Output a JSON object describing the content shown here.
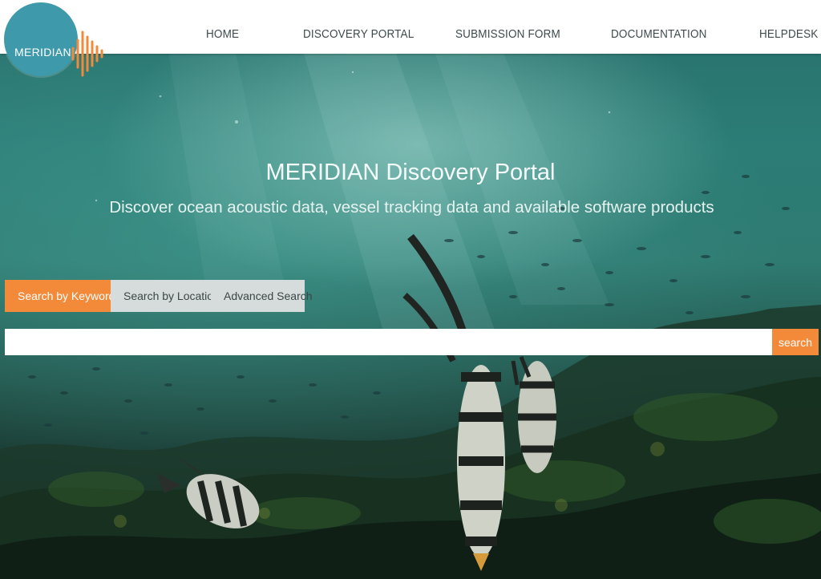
{
  "brand": {
    "logo_text": "MERIDIAN",
    "primary_color": "#3e9aab",
    "accent_color": "#f28a3a"
  },
  "nav": {
    "items": [
      {
        "label": "HOME"
      },
      {
        "label": "DISCOVERY PORTAL"
      },
      {
        "label": "SUBMISSION FORM"
      },
      {
        "label": "DOCUMENTATION"
      },
      {
        "label": "HELPDESK"
      }
    ]
  },
  "hero": {
    "title": "MERIDIAN Discovery Portal",
    "subtitle": "Discover ocean acoustic data, vessel tracking data and available software products"
  },
  "search": {
    "tabs": [
      {
        "label": "Search by Keywords",
        "active": true
      },
      {
        "label": "Search by Location",
        "active": false
      },
      {
        "label": "Advanced Search",
        "active": false
      }
    ],
    "input_value": "",
    "placeholder": "",
    "button_label": "search"
  }
}
